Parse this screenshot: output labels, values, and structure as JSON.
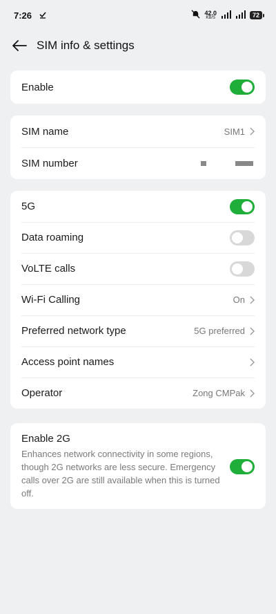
{
  "status": {
    "time": "7:26",
    "speed_value": "42.0",
    "speed_unit": "KB/S",
    "battery": "72"
  },
  "header": {
    "title": "SIM info & settings"
  },
  "card_enable": {
    "label": "Enable",
    "enabled": true
  },
  "card_sim": {
    "name_label": "SIM name",
    "name_value": "SIM1",
    "number_label": "SIM number"
  },
  "network": {
    "fiveg_label": "5G",
    "fiveg_on": true,
    "roaming_label": "Data roaming",
    "roaming_on": false,
    "volte_label": "VoLTE calls",
    "volte_on": false,
    "wifi_label": "Wi-Fi Calling",
    "wifi_value": "On",
    "pref_label": "Preferred network type",
    "pref_value": "5G preferred",
    "apn_label": "Access point names",
    "operator_label": "Operator",
    "operator_value": "Zong CMPak"
  },
  "twog": {
    "title": "Enable 2G",
    "description": "Enhances network connectivity in some regions, though 2G networks are less secure. Emergency calls over 2G are still available when this is turned off.",
    "on": true
  },
  "colors": {
    "accent": "#1fae39",
    "background": "#eff0f2",
    "card": "#ffffff"
  }
}
